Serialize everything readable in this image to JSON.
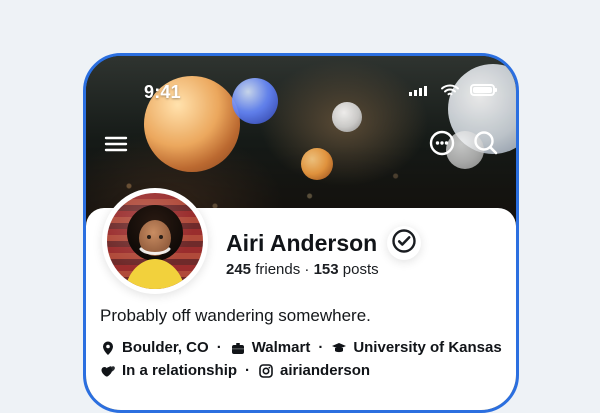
{
  "status_bar": {
    "time": "9:41"
  },
  "profile": {
    "name": "Airi Anderson",
    "friends_count": "245",
    "friends_label": "friends",
    "posts_count": "153",
    "posts_label": "posts",
    "bio": "Probably off wandering somewhere.",
    "details": {
      "location": "Boulder, CO",
      "work": "Walmart",
      "education": "University of Kansas",
      "relationship": "In a relationship",
      "instagram": "airianderson"
    }
  },
  "icons": {
    "menu": "menu-icon",
    "more": "more-icon",
    "search": "search-icon",
    "verified": "verified-check-icon",
    "location": "location-pin-icon",
    "work": "briefcase-icon",
    "education": "graduation-cap-icon",
    "relationship": "hearts-icon",
    "instagram": "instagram-icon",
    "signal": "cell-signal-icon",
    "wifi": "wifi-icon",
    "battery": "battery-icon"
  },
  "colors": {
    "frame_accent": "#2b6fe0",
    "background": "#eef2f6"
  }
}
